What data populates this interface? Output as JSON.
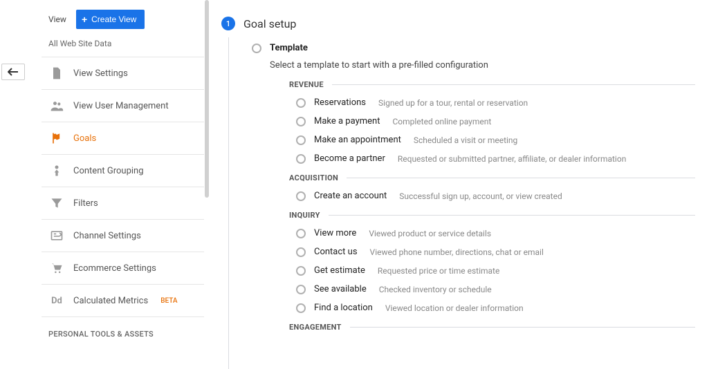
{
  "sidebar": {
    "view_label": "View",
    "create_view": "Create View",
    "all_data": "All Web Site Data",
    "items": [
      {
        "icon": "file",
        "label": "View Settings"
      },
      {
        "icon": "group",
        "label": "View User Management"
      },
      {
        "icon": "flag",
        "label": "Goals",
        "active": true
      },
      {
        "icon": "person-up",
        "label": "Content Grouping"
      },
      {
        "icon": "filter",
        "label": "Filters"
      },
      {
        "icon": "channel",
        "label": "Channel Settings"
      },
      {
        "icon": "cart",
        "label": "Ecommerce Settings"
      },
      {
        "icon": "dd",
        "label": "Calculated Metrics",
        "badge": "BETA"
      }
    ],
    "section": "PERSONAL TOOLS & ASSETS"
  },
  "main": {
    "step": {
      "num": "1",
      "title": "Goal setup"
    },
    "template": {
      "label": "Template",
      "sub": "Select a template to start with a pre-filled configuration"
    },
    "categories": [
      {
        "name": "REVENUE",
        "options": [
          {
            "name": "Reservations",
            "desc": "Signed up for a tour, rental or reservation"
          },
          {
            "name": "Make a payment",
            "desc": "Completed online payment"
          },
          {
            "name": "Make an appointment",
            "desc": "Scheduled a visit or meeting"
          },
          {
            "name": "Become a partner",
            "desc": "Requested or submitted partner, affiliate, or dealer information"
          }
        ]
      },
      {
        "name": "ACQUISITION",
        "options": [
          {
            "name": "Create an account",
            "desc": "Successful sign up, account, or view created"
          }
        ]
      },
      {
        "name": "INQUIRY",
        "options": [
          {
            "name": "View more",
            "desc": "Viewed product or service details"
          },
          {
            "name": "Contact us",
            "desc": "Viewed phone number, directions, chat or email"
          },
          {
            "name": "Get estimate",
            "desc": "Requested price or time estimate"
          },
          {
            "name": "See available",
            "desc": "Checked inventory or schedule"
          },
          {
            "name": "Find a location",
            "desc": "Viewed location or dealer information"
          }
        ]
      },
      {
        "name": "ENGAGEMENT",
        "options": []
      }
    ]
  }
}
